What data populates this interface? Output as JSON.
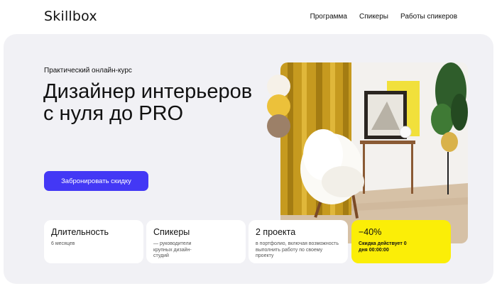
{
  "header": {
    "logo": "Skillbox",
    "nav": [
      "Программа",
      "Спикеры",
      "Работы спикеров"
    ]
  },
  "hero": {
    "eyebrow": "Практический онлайн-курс",
    "title": "Дизайнер интерьеров с нуля до PRO",
    "cta_label": "Забронировать скидку"
  },
  "cards": [
    {
      "heading": "Длительность",
      "sub": "6 месяцев"
    },
    {
      "heading": "Спикеры",
      "sub": "— руководители крупных дизайн-студий"
    },
    {
      "heading": "2 проекта",
      "sub": "в портфолио, включая возможность выполнить работу по своему проекту"
    },
    {
      "heading": "−40%",
      "sub": "Скидка действует 0 дня 00:00:00"
    }
  ],
  "colors": {
    "accent": "#4338f5",
    "discount_card": "#fbee07",
    "swatches": [
      "#f6f1e8",
      "#ecc13a",
      "#9c8068"
    ]
  }
}
